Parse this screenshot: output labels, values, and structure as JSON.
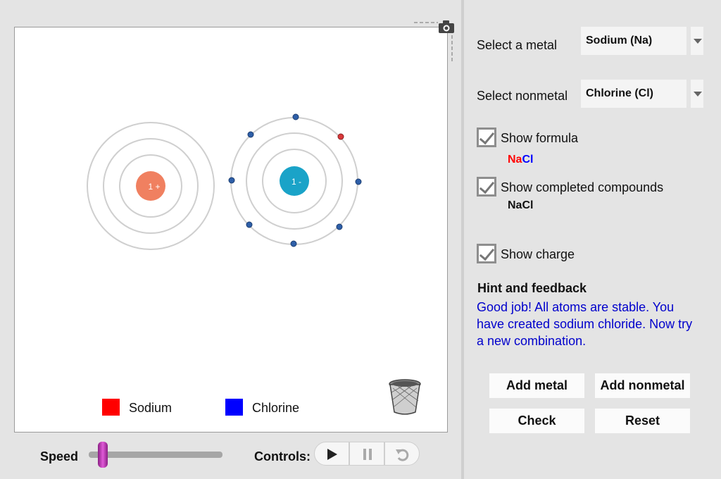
{
  "legend": {
    "metal_label": "Sodium",
    "metal_color": "#ff0000",
    "nonmetal_label": "Chlorine",
    "nonmetal_color": "#0000ff"
  },
  "atoms": {
    "metal_charge": "1 +",
    "metal_nucleus_color": "#f08060",
    "nonmetal_charge": "1 -",
    "nonmetal_nucleus_color": "#1aa3c8"
  },
  "bottom": {
    "speed_label": "Speed",
    "controls_label": "Controls:"
  },
  "panel": {
    "metal_label": "Select a metal",
    "metal_value": "Sodium (Na)",
    "nonmetal_label": "Select nonmetal",
    "nonmetal_value": "Chlorine (Cl)",
    "show_formula_label": "Show formula",
    "formula_metal": "Na",
    "formula_nonmetal": "Cl",
    "show_completed_label": "Show completed compounds",
    "completed_compound": "NaCl",
    "show_charge_label": "Show charge",
    "hint_title": "Hint and feedback",
    "hint_text_line1": "Good job! All atoms are stable. You",
    "hint_text_line2": "have created sodium chloride. Now try",
    "hint_text_line3": "a new combination.",
    "hint_color": "#0000cc"
  },
  "buttons": {
    "add_metal": "Add metal",
    "add_nonmetal": "Add nonmetal",
    "check": "Check",
    "reset": "Reset"
  }
}
